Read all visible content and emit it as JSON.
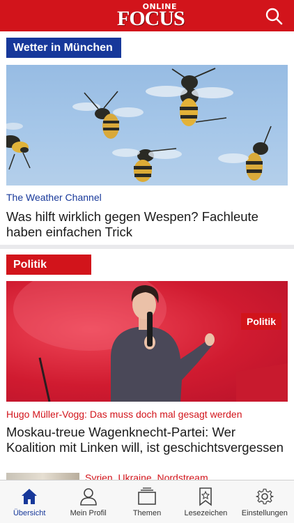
{
  "header": {
    "logo_online": "ONLINE",
    "logo_focus": "FOCUS",
    "search_icon": "search-icon",
    "background_color": "#d2141b"
  },
  "weather_section": {
    "label": "Wetter in München",
    "label_color": "#17389a",
    "image_icon": "wasps-photo",
    "source": "The Weather Channel",
    "headline": "Was hilft wirklich gegen Wespen? Fachleute haben einfachen Trick"
  },
  "politik_section": {
    "label": "Politik",
    "label_color": "#d2141b",
    "image_icon": "speaker-on-stage-photo",
    "tag": "Politik",
    "source": "Hugo Müller-Vogg: Das muss doch mal gesagt werden",
    "headline": "Moskau-treue Wagenknecht-Partei: Wer Koalition mit Linken will, ist geschichtsvergessen"
  },
  "next_item": {
    "text": "Syrien, Ukraine, Nordstream"
  },
  "tabbar": {
    "active_color": "#17389a",
    "items": [
      {
        "label": "Übersicht",
        "icon": "home-icon"
      },
      {
        "label": "Mein Profil",
        "icon": "profile-icon"
      },
      {
        "label": "Themen",
        "icon": "topics-icon"
      },
      {
        "label": "Lesezeichen",
        "icon": "bookmark-star-icon"
      },
      {
        "label": "Einstellungen",
        "icon": "gear-icon"
      }
    ]
  }
}
